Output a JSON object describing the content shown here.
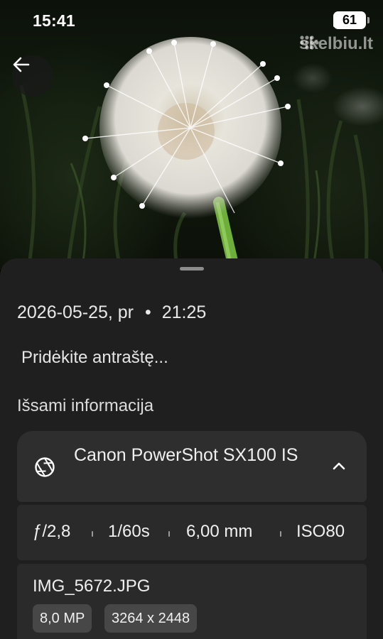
{
  "status_bar": {
    "time": "15:41",
    "battery": "61",
    "watermark": "skelbiu.lt"
  },
  "photo": {
    "subject_icon": "dandelion-photo"
  },
  "toolbar": {
    "back_icon": "arrow-left-icon"
  },
  "details": {
    "date": "2026-05-25, pr",
    "separator": "•",
    "time": "21:25",
    "caption_placeholder": "Pridėkite antraštę...",
    "section_title": "Išsami informacija",
    "camera": {
      "icon": "aperture-icon",
      "name": "Canon PowerShot SX100 IS",
      "expand_icon": "chevron-up-icon"
    },
    "exif": {
      "aperture": "ƒ/2,8",
      "shutter": "1/60s",
      "focal_length": "6,00 mm",
      "iso": "ISO80"
    },
    "file": {
      "name": "IMG_5672.JPG",
      "megapixels": "8,0 MP",
      "resolution": "3264 x 2448"
    }
  },
  "colors": {
    "sheet_bg": "#1f1f1f",
    "card_bg": "#2e2e2e",
    "chip_bg": "#474747"
  }
}
